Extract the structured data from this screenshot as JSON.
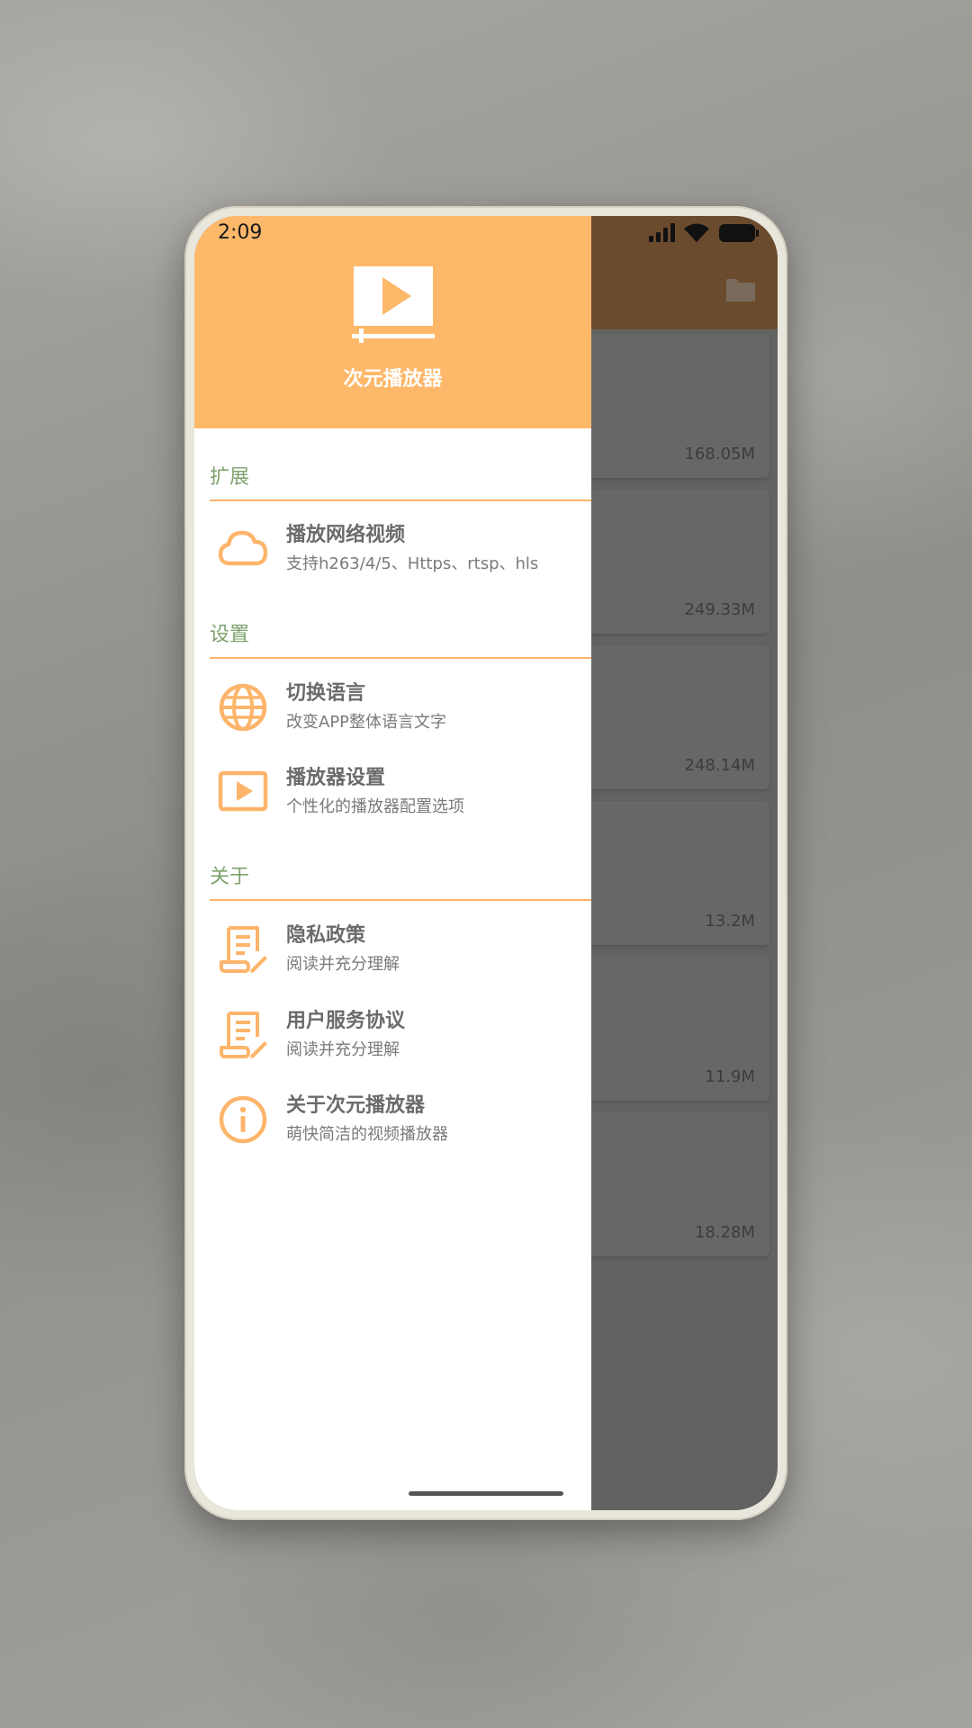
{
  "status_bar": {
    "time": "2:09"
  },
  "drawer": {
    "app_name": "次元播放器",
    "sections": [
      {
        "title": "扩展",
        "items": [
          {
            "title": "播放网络视频",
            "subtitle": "支持h263/4/5、Https、rtsp、hls",
            "icon": "cloud-icon"
          }
        ]
      },
      {
        "title": "设置",
        "items": [
          {
            "title": "切换语言",
            "subtitle": "改变APP整体语言文字",
            "icon": "globe-icon"
          },
          {
            "title": "播放器设置",
            "subtitle": "个性化的播放器配置选项",
            "icon": "player-icon"
          }
        ]
      },
      {
        "title": "关于",
        "items": [
          {
            "title": "隐私政策",
            "subtitle": "阅读并充分理解",
            "icon": "document-edit-icon"
          },
          {
            "title": "用户服务协议",
            "subtitle": "阅读并充分理解",
            "icon": "document-edit-icon"
          },
          {
            "title": "关于次元播放器",
            "subtitle": "萌快简洁的视频播放器",
            "icon": "info-icon"
          }
        ]
      }
    ]
  },
  "background_list": {
    "items": [
      {
        "size": "168.05M"
      },
      {
        "size": "249.33M"
      },
      {
        "size": "248.14M"
      },
      {
        "size": "13.2M"
      },
      {
        "size": "11.9M"
      },
      {
        "size": "18.28M"
      }
    ]
  },
  "colors": {
    "drawer_header": "#feb86a",
    "accent_line": "#fcb26b",
    "section_title": "#7fa36e",
    "icon_orange": "#fdb56b",
    "toolbar_dimmed": "#6b4b2e"
  }
}
